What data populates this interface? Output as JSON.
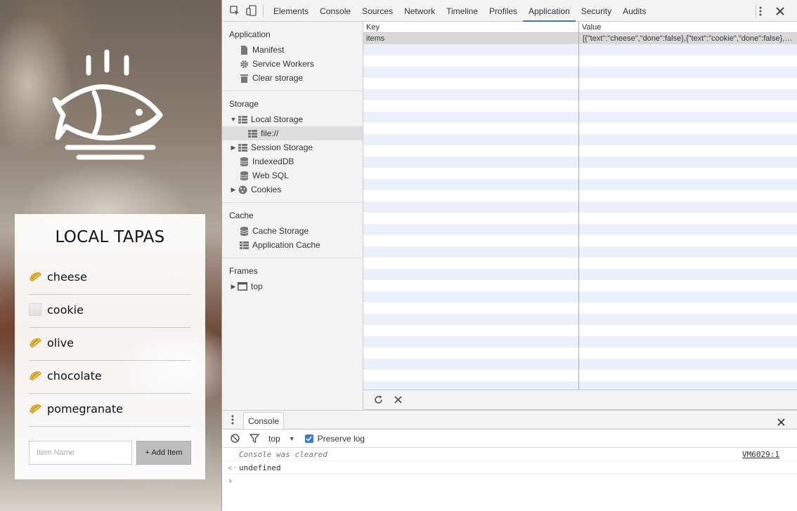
{
  "app": {
    "title": "LOCAL TAPAS",
    "items": [
      {
        "text": "cheese",
        "done": true
      },
      {
        "text": "cookie",
        "done": false
      },
      {
        "text": "olive",
        "done": true
      },
      {
        "text": "chocolate",
        "done": true
      },
      {
        "text": "pomegranate",
        "done": true
      }
    ],
    "input_placeholder": "Item Name",
    "add_button_label": "+ Add Item"
  },
  "devtools": {
    "tabs": [
      "Elements",
      "Console",
      "Sources",
      "Network",
      "Timeline",
      "Profiles",
      "Application",
      "Security",
      "Audits"
    ],
    "active_tab": "Application",
    "accent_color": "#3879d9",
    "sidebar": {
      "application": {
        "heading": "Application",
        "items": [
          "Manifest",
          "Service Workers",
          "Clear storage"
        ]
      },
      "storage": {
        "heading": "Storage",
        "local_storage": "Local Storage",
        "local_storage_child": "file://",
        "session_storage": "Session Storage",
        "indexeddb": "IndexedDB",
        "web_sql": "Web SQL",
        "cookies": "Cookies"
      },
      "cache": {
        "heading": "Cache",
        "items": [
          "Cache Storage",
          "Application Cache"
        ]
      },
      "frames": {
        "heading": "Frames",
        "top": "top"
      }
    },
    "table": {
      "columns": [
        "Key",
        "Value"
      ],
      "rows": [
        {
          "key": "items",
          "value": "[{\"text\":\"cheese\",\"done\":false},{\"text\":\"cookie\",\"done\":false},{\"text\":\"olive\",\"done\":false},{\"text\":\"chocolate\",\"done\":false},{\"text\":\"pomegranate\",\"done\":false}]"
        }
      ]
    },
    "console": {
      "tab_label": "Console",
      "context": "top",
      "preserve_log_label": "Preserve log",
      "preserve_log_checked": true,
      "messages": [
        {
          "text": "Console was cleared",
          "source": "VM6029:1"
        },
        {
          "text": "undefined"
        }
      ]
    }
  }
}
